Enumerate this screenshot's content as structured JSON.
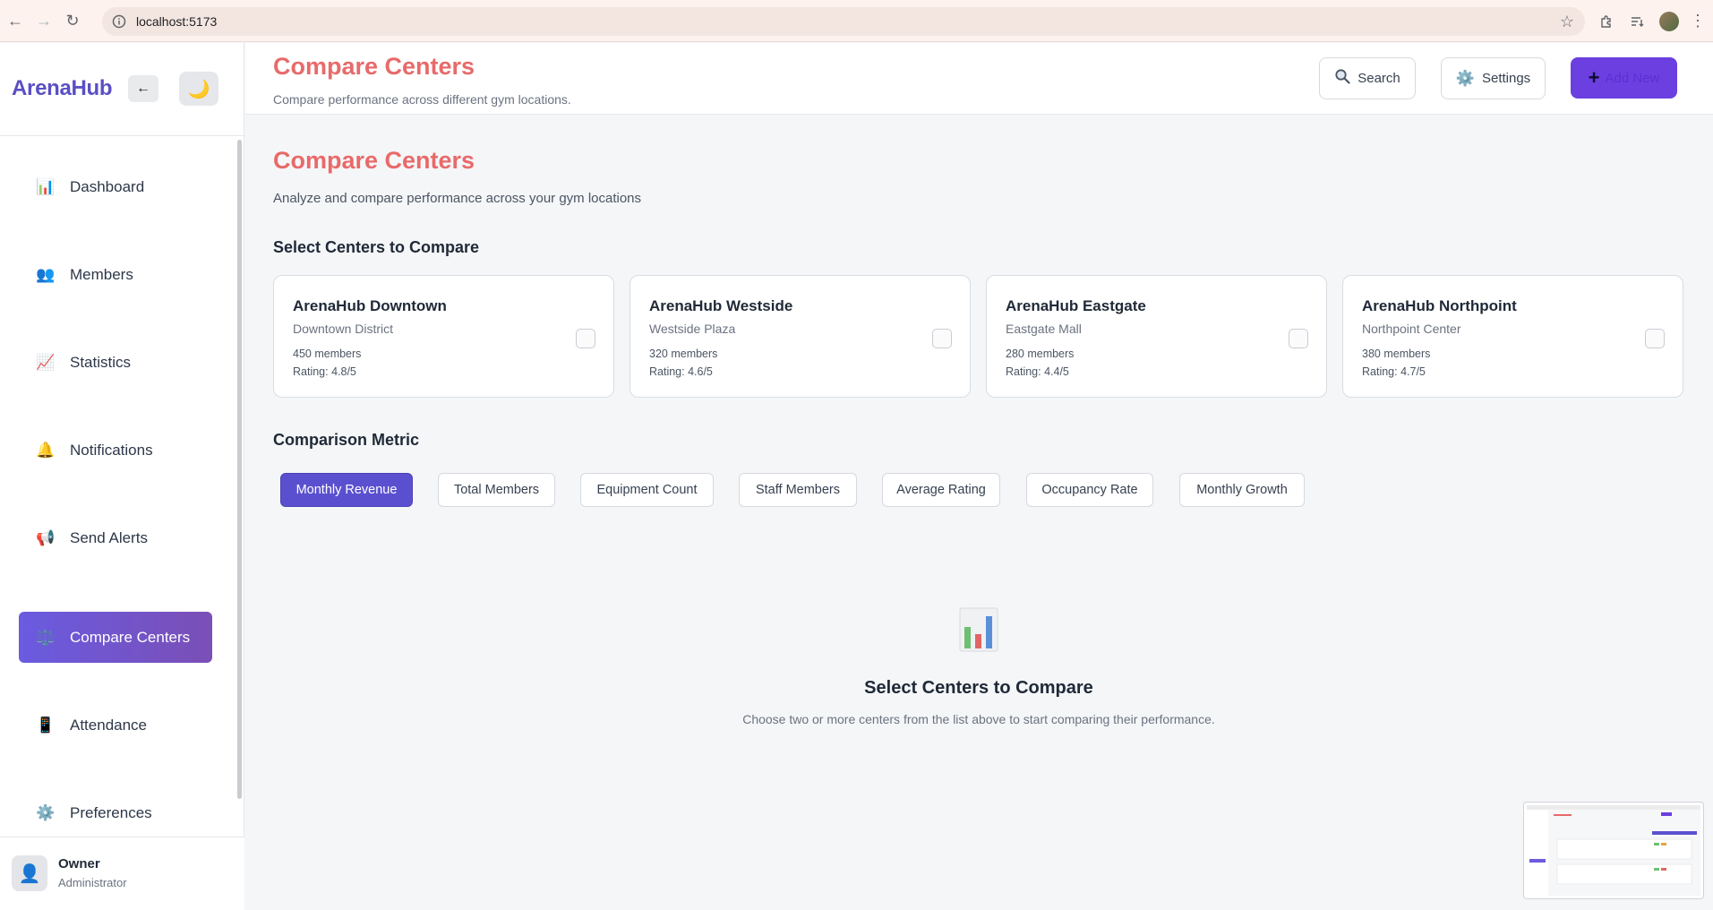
{
  "browser": {
    "url": "localhost:5173"
  },
  "sidebar": {
    "brand": "ArenaHub",
    "collapse_icon": "arrow-left-icon",
    "theme_icon": "moon-icon",
    "items": [
      {
        "label": "Dashboard",
        "icon": "bar-chart-icon",
        "glyph": "📊",
        "active": false
      },
      {
        "label": "Members",
        "icon": "users-icon",
        "glyph": "👥",
        "active": false
      },
      {
        "label": "Statistics",
        "icon": "trend-chart-icon",
        "glyph": "📈",
        "active": false
      },
      {
        "label": "Notifications",
        "icon": "bell-icon",
        "glyph": "🔔",
        "active": false
      },
      {
        "label": "Send Alerts",
        "icon": "megaphone-icon",
        "glyph": "📢",
        "active": false
      },
      {
        "label": "Compare Centers",
        "icon": "scales-icon",
        "glyph": "⚖️",
        "active": true
      },
      {
        "label": "Attendance",
        "icon": "phone-icon",
        "glyph": "📱",
        "active": false
      },
      {
        "label": "Preferences",
        "icon": "gear-icon",
        "glyph": "⚙️",
        "active": false
      }
    ],
    "user": {
      "name": "Owner",
      "role": "Administrator",
      "avatar_icon": "user-silhouette-icon"
    }
  },
  "header": {
    "title": "Compare Centers",
    "subtitle": "Compare performance across different gym locations.",
    "search_label": "Search",
    "settings_label": "Settings",
    "add_label": "Add New"
  },
  "main": {
    "title": "Compare Centers",
    "subtitle": "Analyze and compare performance across your gym locations",
    "select_heading": "Select Centers to Compare",
    "centers": [
      {
        "name": "ArenaHub Downtown",
        "location": "Downtown District",
        "members": "450 members",
        "rating": "Rating: 4.8/5",
        "selected": false
      },
      {
        "name": "ArenaHub Westside",
        "location": "Westside Plaza",
        "members": "320 members",
        "rating": "Rating: 4.6/5",
        "selected": false
      },
      {
        "name": "ArenaHub Eastgate",
        "location": "Eastgate Mall",
        "members": "280 members",
        "rating": "Rating: 4.4/5",
        "selected": false
      },
      {
        "name": "ArenaHub Northpoint",
        "location": "Northpoint Center",
        "members": "380 members",
        "rating": "Rating: 4.7/5",
        "selected": false
      }
    ],
    "metric_heading": "Comparison Metric",
    "metrics": [
      {
        "label": "Monthly Revenue",
        "active": true
      },
      {
        "label": "Total Members",
        "active": false
      },
      {
        "label": "Equipment Count",
        "active": false
      },
      {
        "label": "Staff Members",
        "active": false
      },
      {
        "label": "Average Rating",
        "active": false
      },
      {
        "label": "Occupancy Rate",
        "active": false
      },
      {
        "label": "Monthly Growth",
        "active": false
      }
    ],
    "empty_state": {
      "icon": "bar-chart-icon",
      "title": "Select Centers to Compare",
      "message": "Choose two or more centers from the list above to start comparing their performance."
    }
  },
  "colors": {
    "brand": "#5b4fc4",
    "title_accent": "#e86a6a",
    "active_nav_start": "#6a5be0",
    "active_nav_end": "#7a4fb6",
    "metric_active": "#5a50cf",
    "add_button": "#6b3fe0"
  }
}
